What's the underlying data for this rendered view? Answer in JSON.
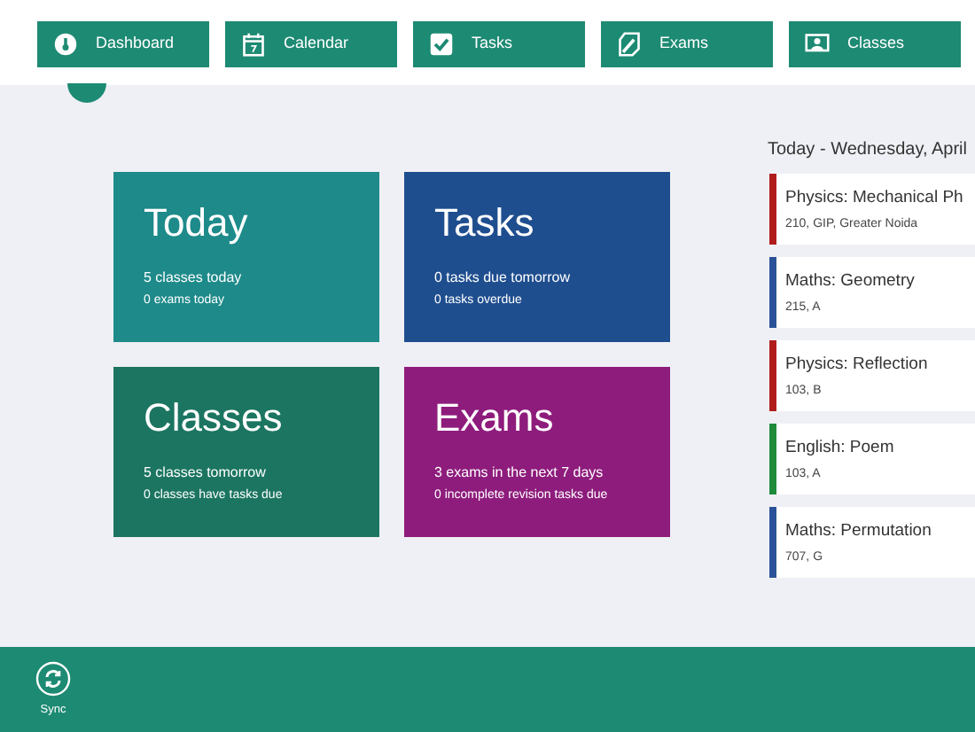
{
  "nav": [
    {
      "label": "Dashboard",
      "kind": "dashboard"
    },
    {
      "label": "Calendar",
      "kind": "calendar"
    },
    {
      "label": "Tasks",
      "kind": "tasks"
    },
    {
      "label": "Exams",
      "kind": "exams"
    },
    {
      "label": "Classes",
      "kind": "classes"
    }
  ],
  "tiles": [
    {
      "title": "Today",
      "lines": [
        "5 classes today",
        "0 exams today"
      ],
      "color": "#1e8a8a"
    },
    {
      "title": "Tasks",
      "lines": [
        "0 tasks due tomorrow",
        "0 tasks overdue"
      ],
      "color": "#1f4e8f"
    },
    {
      "title": "Classes",
      "lines": [
        "5 classes tomorrow",
        "0 classes have tasks due"
      ],
      "color": "#1b7561"
    },
    {
      "title": "Exams",
      "lines": [
        "3 exams in the next 7 days",
        "0 incomplete revision tasks due"
      ],
      "color": "#8e1c7c"
    }
  ],
  "schedule": {
    "heading": "Today - Wednesday, April",
    "classes": [
      {
        "subject": "Physics: Mechanical Ph",
        "room": "210, GIP, Greater Noida",
        "color": "#b01c1c"
      },
      {
        "subject": "Maths: Geometry",
        "room": "215, A",
        "color": "#2a5298"
      },
      {
        "subject": "Physics: Reflection",
        "room": "103, B",
        "color": "#b01c1c"
      },
      {
        "subject": "English: Poem",
        "room": "103, A",
        "color": "#1e8a3a"
      },
      {
        "subject": "Maths: Permutation",
        "room": "707, G",
        "color": "#2a5298"
      }
    ]
  },
  "app_bar": {
    "buttons": [
      {
        "label": "Sync"
      }
    ]
  }
}
